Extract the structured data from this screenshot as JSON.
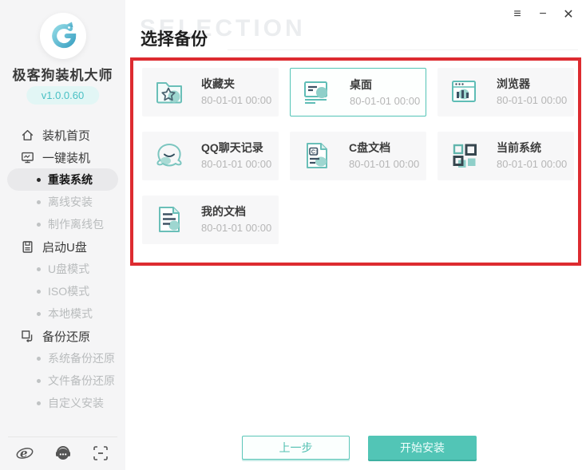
{
  "window": {
    "controls": {
      "menu": "≡",
      "minimize": "−",
      "close": "✕"
    }
  },
  "sidebar": {
    "app_title": "极客狗装机大师",
    "version": "v1.0.0.60",
    "items": [
      {
        "label": "装机首页",
        "type": "section",
        "icon": "home"
      },
      {
        "label": "一键装机",
        "type": "section",
        "icon": "monitor"
      },
      {
        "label": "重装系统",
        "type": "sub",
        "state": "active"
      },
      {
        "label": "离线安装",
        "type": "sub",
        "state": "disabled"
      },
      {
        "label": "制作离线包",
        "type": "sub",
        "state": "disabled"
      },
      {
        "label": "启动U盘",
        "type": "section",
        "icon": "usb-disk"
      },
      {
        "label": "U盘模式",
        "type": "sub",
        "state": "disabled"
      },
      {
        "label": "ISO模式",
        "type": "sub",
        "state": "disabled"
      },
      {
        "label": "本地模式",
        "type": "sub",
        "state": "disabled"
      },
      {
        "label": "备份还原",
        "type": "section",
        "icon": "backup-restore"
      },
      {
        "label": "系统备份还原",
        "type": "sub",
        "state": "disabled"
      },
      {
        "label": "文件备份还原",
        "type": "sub",
        "state": "disabled"
      },
      {
        "label": "自定义安装",
        "type": "sub",
        "state": "disabled"
      }
    ]
  },
  "main": {
    "watermark": "SELECTION",
    "title": "选择备份",
    "cards": [
      {
        "title": "收藏夹",
        "date": "80-01-01 00:00",
        "icon": "folder-star",
        "selected": false
      },
      {
        "title": "桌面",
        "date": "80-01-01 00:00",
        "icon": "desktop",
        "selected": true
      },
      {
        "title": "浏览器",
        "date": "80-01-01 00:00",
        "icon": "browser",
        "selected": false
      },
      {
        "title": "QQ聊天记录",
        "date": "80-01-01 00:00",
        "icon": "qq",
        "selected": false
      },
      {
        "title": "C盘文档",
        "date": "80-01-01 00:00",
        "icon": "c-drive-document",
        "icon_text": "C:",
        "selected": false
      },
      {
        "title": "当前系统",
        "date": "80-01-01 00:00",
        "icon": "current-system",
        "selected": false
      },
      {
        "title": "我的文档",
        "date": "80-01-01 00:00",
        "icon": "my-documents",
        "selected": false
      }
    ],
    "buttons": {
      "previous": "上一步",
      "start_install": "开始安装"
    }
  },
  "colors": {
    "accent_teal": "#52c5b6",
    "annotation_red": "#dd2b30",
    "sidebar_bg": "#f5f5f6",
    "card_bg": "#f7f7f8"
  }
}
